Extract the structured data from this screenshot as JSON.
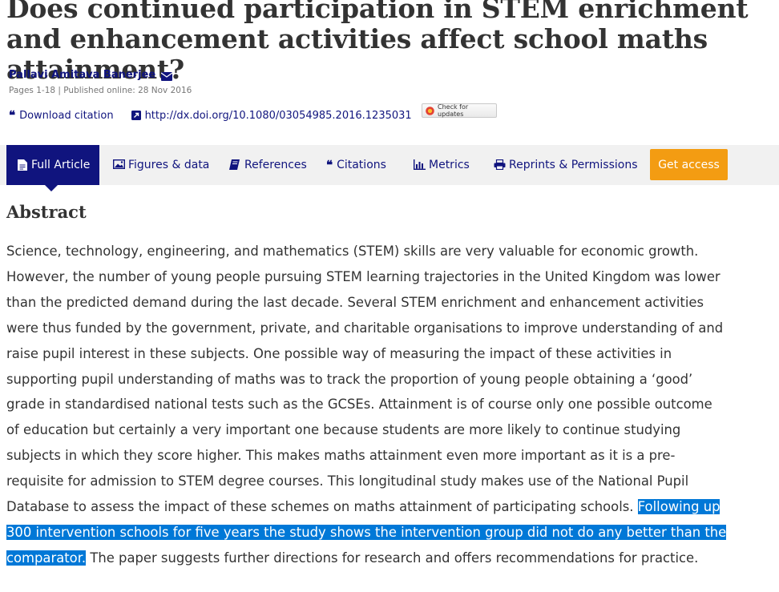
{
  "article": {
    "title": "Does continued participation in STEM enrichment and enhancement activities affect school maths attainment?",
    "author": "Pallavi Amitava Banerjee",
    "pub_info": "Pages 1-18 | Published online: 28 Nov 2016",
    "download_citation": "Download citation",
    "doi": "http://dx.doi.org/10.1080/03054985.2016.1235031",
    "check_updates": "Check for updates"
  },
  "tabs": {
    "full_article": "Full Article",
    "figures": "Figures & data",
    "references": "References",
    "citations": "Citations",
    "metrics": "Metrics",
    "reprints": "Reprints & Permissions",
    "get_access": "Get access"
  },
  "abstract": {
    "heading": "Abstract",
    "text_before": "Science, technology, engineering, and mathematics (STEM) skills are very valuable for economic growth. However, the number of young people pursuing STEM learning trajectories in the United Kingdom was lower than the predicted demand during the last decade. Several STEM enrichment and enhancement activities were thus funded by the government, private, and charitable organisations to improve understanding of and raise pupil interest in these subjects. One possible way of measuring the impact of these activities in supporting pupil understanding of maths was to track the proportion of young people obtaining a ‘good’ grade in standardised national tests such as the GCSEs. Attainment is of course only one possible outcome of education but certainly a very important one because students are more likely to continue studying subjects in which they score higher. This makes maths attainment even more important as it is a pre-requisite for admission to STEM degree courses. This longitudinal study makes use of the National Pupil Database to assess the impact of these schemes on maths attainment of participating schools. ",
    "text_selected": "Following up 300 intervention schools for five years the study shows the intervention group did not do any better than the comparator.",
    "text_after": " The paper suggests further directions for research and offers recommendations for practice."
  },
  "colors": {
    "brand": "#10147e",
    "access": "#f39c12",
    "selection": "#0078d7"
  }
}
